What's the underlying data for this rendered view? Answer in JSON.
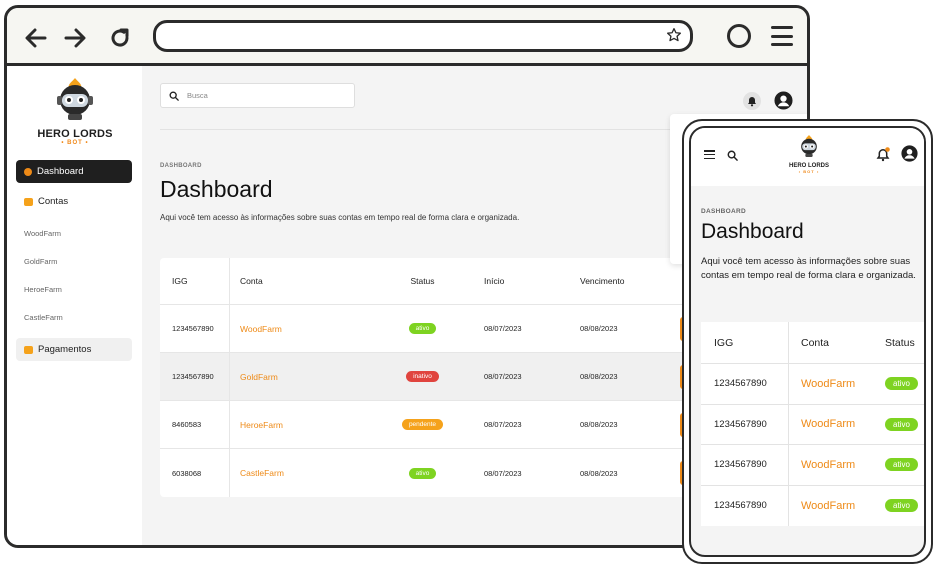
{
  "colors": {
    "accent": "#ee8a17",
    "active": "#7ed321",
    "inactive": "#e0443e",
    "pending": "#f5a21b",
    "frame": "#2b2b2b"
  },
  "browser": {
    "icons": [
      "back-arrow-icon",
      "forward-arrow-icon",
      "reload-icon",
      "star-icon",
      "circle-icon",
      "hamburger-menu-icon"
    ]
  },
  "brand": {
    "name": "HERO LORDS",
    "tag": "• BOT •"
  },
  "sidebar": {
    "items": [
      {
        "label": "Dashboard"
      },
      {
        "label": "Contas"
      },
      {
        "label": "WoodFarm"
      },
      {
        "label": "GoldFarm"
      },
      {
        "label": "HeroeFarm"
      },
      {
        "label": "CastleFarm"
      },
      {
        "label": "Pagamentos"
      }
    ]
  },
  "header": {
    "search_placeholder": "Busca"
  },
  "page": {
    "breadcrumb": "DASHBOARD",
    "title": "Dashboard",
    "description": "Aqui você tem acesso às informações sobre suas contas em tempo real de forma clara e organizada."
  },
  "table": {
    "columns": [
      "IGG",
      "Conta",
      "Status",
      "Início",
      "Vencimento"
    ],
    "rows": [
      {
        "igg": "1234567890",
        "conta": "WoodFarm",
        "status": "ativo",
        "inicio": "08/07/2023",
        "vencimento": "08/08/2023"
      },
      {
        "igg": "1234567890",
        "conta": "GoldFarm",
        "status": "inativo",
        "inicio": "08/07/2023",
        "vencimento": "08/08/2023"
      },
      {
        "igg": "8460583",
        "conta": "HeroeFarm",
        "status": "pendente",
        "inicio": "08/07/2023",
        "vencimento": "08/08/2023"
      },
      {
        "igg": "6038068",
        "conta": "CastleFarm",
        "status": "ativo",
        "inicio": "08/07/2023",
        "vencimento": "08/08/2023"
      }
    ]
  },
  "mobile": {
    "breadcrumb": "DASHBOARD",
    "title": "Dashboard",
    "description": "Aqui você tem acesso às informações sobre suas contas em tempo real de forma clara e organizada.",
    "columns": [
      "IGG",
      "Conta",
      "Status"
    ],
    "rows": [
      {
        "igg": "1234567890",
        "conta": "WoodFarm",
        "status": "ativo"
      },
      {
        "igg": "1234567890",
        "conta": "WoodFarm",
        "status": "ativo"
      },
      {
        "igg": "1234567890",
        "conta": "WoodFarm",
        "status": "ativo"
      },
      {
        "igg": "1234567890",
        "conta": "WoodFarm",
        "status": "ativo"
      }
    ]
  }
}
